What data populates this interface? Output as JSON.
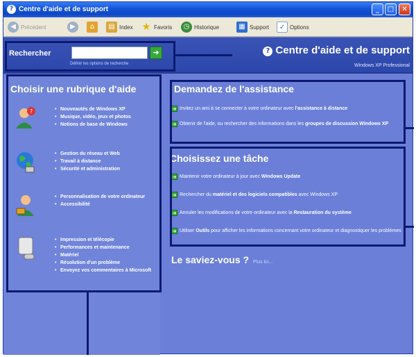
{
  "window": {
    "title": "Centre d'aide et de support",
    "buttons": {
      "minimize": "_",
      "maximize": "□",
      "close": "✕"
    }
  },
  "toolbar": {
    "back": "Précédent",
    "index": "Index",
    "favorites": "Favoris",
    "history": "Historique",
    "support": "Support",
    "options": "Options"
  },
  "header": {
    "search_label": "Rechercher",
    "search_placeholder": "",
    "search_options": "Définir les options de recherche",
    "center_title": "Centre d'aide et de support",
    "edition": "Windows XP Professional"
  },
  "left": {
    "title": "Choisir une rubrique d'aide",
    "groups": [
      {
        "icon": "user-help-icon",
        "items": [
          "Nouveautés de Windows XP",
          "Musique, vidéo, jeux et photos",
          "Notions de base de Windows"
        ]
      },
      {
        "icon": "globe-network-icon",
        "items": [
          "Gestion du réseau et Web",
          "Travail à distance",
          "Sécurité et administration"
        ]
      },
      {
        "icon": "user-settings-icon",
        "items": [
          "Personnalisation de votre ordinateur",
          "Accessibilité"
        ]
      },
      {
        "icon": "computer-icon",
        "items": [
          "Impression et télécopie",
          "Performances et maintenance",
          "Matériel",
          "Résolution d'un problème",
          "Envoyez vos commentaires à Microsoft"
        ]
      }
    ]
  },
  "assist": {
    "title": "Demandez de l'assistance",
    "items": [
      {
        "prefix": "Invitez un ami à se connecter à votre ordinateur avec ",
        "bold": "l'assistance à distance",
        "suffix": ""
      },
      {
        "prefix": "Obtenir de l'aide, ou rechercher des informations dans les ",
        "bold": "groupes de discussion Windows XP",
        "suffix": ""
      }
    ]
  },
  "tasks": {
    "title": "Choisissez une tâche",
    "items": [
      {
        "prefix": "Maintenir votre ordinateur à jour avec ",
        "bold": "Windows Update",
        "suffix": ""
      },
      {
        "prefix": "Rechercher du ",
        "bold": "matériel et des logiciels compatibles",
        "suffix": " avec Windows XP"
      },
      {
        "prefix": "Annuler les modifications de votre ordinateur avec la ",
        "bold": "Restauration du système",
        "suffix": ""
      },
      {
        "prefix": "Utiliser ",
        "bold": "Outils",
        "suffix": " pour afficher les informations concernant votre ordinateur et diagnostiquer les problèmes"
      }
    ]
  },
  "didyouknow": {
    "title": "Le saviez-vous ?",
    "more": "Plus ici..."
  }
}
